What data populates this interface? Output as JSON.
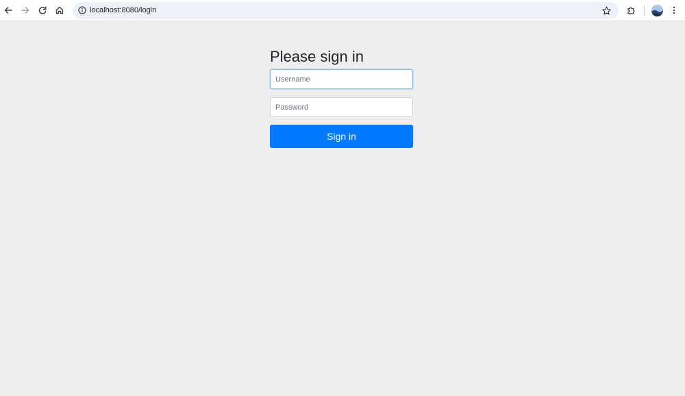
{
  "browser": {
    "url": "localhost:8080/login",
    "icons": {
      "back": "arrow-left-icon",
      "forward": "arrow-right-icon",
      "reload": "reload-icon",
      "home": "home-icon",
      "site_info": "info-icon",
      "bookmark": "star-icon",
      "extensions": "puzzle-piece-icon",
      "profile": "avatar",
      "menu": "kebab-menu-icon"
    }
  },
  "login": {
    "heading": "Please sign in",
    "username": {
      "placeholder": "Username",
      "value": "",
      "focused": true
    },
    "password": {
      "placeholder": "Password",
      "value": ""
    },
    "submit_label": "Sign in"
  },
  "colors": {
    "page_background": "#eeeeee",
    "primary_button": "#007bff",
    "focus_border": "#80bdff",
    "heading_text": "#212529"
  }
}
